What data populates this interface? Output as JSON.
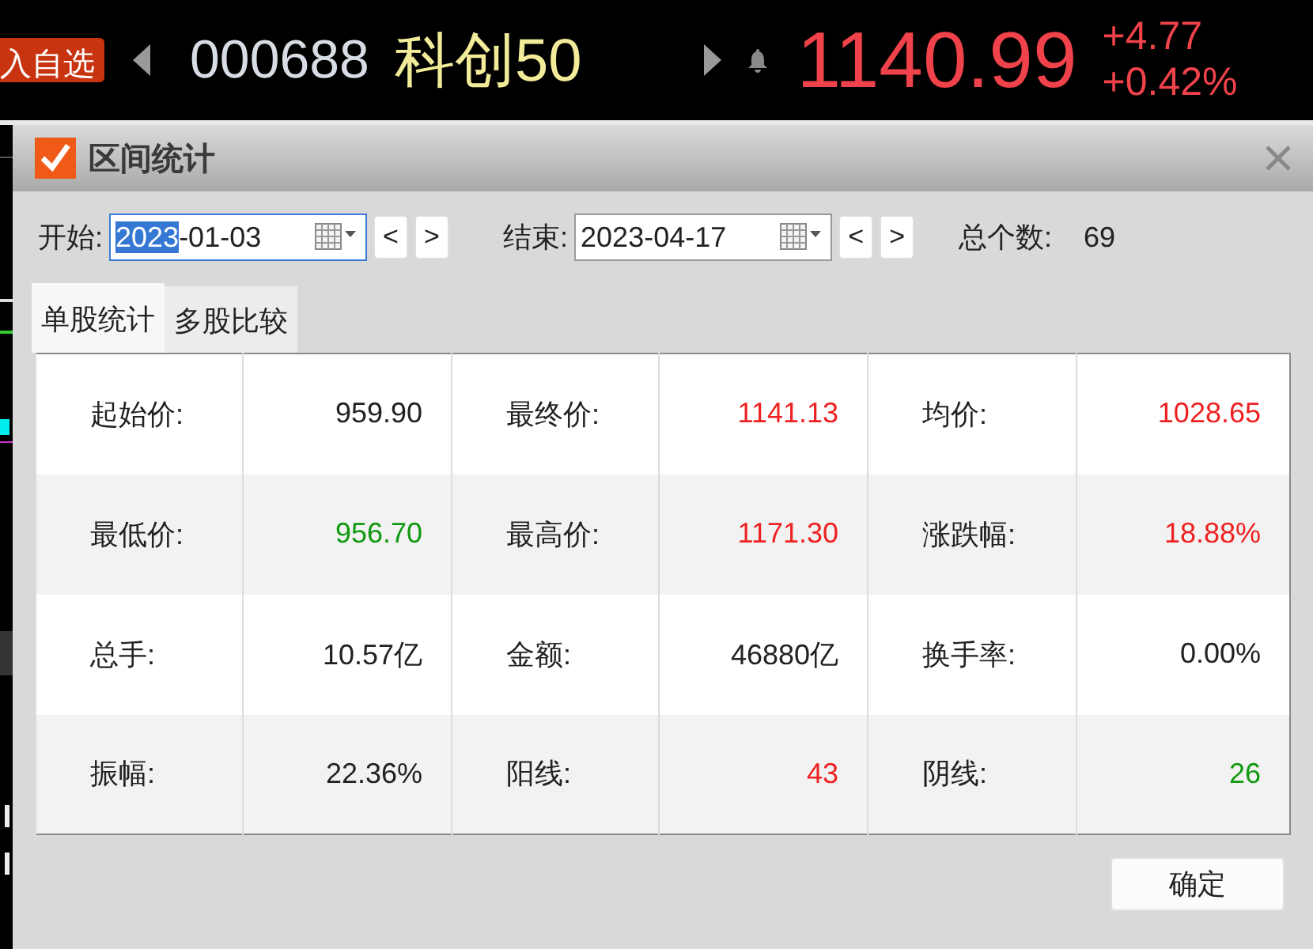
{
  "quote_bar": {
    "add_button": "入自选",
    "code": "000688",
    "name": "科创50",
    "price": "1140.99",
    "change": "+4.77",
    "change_pct": "+0.42%"
  },
  "dialog": {
    "title": "区间统计",
    "start": {
      "label": "开始:",
      "segments": [
        {
          "text": "2023",
          "selected": true
        },
        {
          "text": "-01-03",
          "selected": false
        }
      ],
      "prev": "<",
      "next": ">"
    },
    "end": {
      "label": "结束:",
      "segments": [
        {
          "text": "2023-04-17",
          "selected": false
        }
      ],
      "prev": "<",
      "next": ">"
    },
    "count_label": "总个数:",
    "count": "69",
    "tabs": [
      {
        "label": "单股统计",
        "selected": true
      },
      {
        "label": "多股比较",
        "selected": false
      }
    ],
    "rows": [
      [
        {
          "label": "起始价:",
          "value": "959.90",
          "color": "#222222"
        },
        {
          "label": "最终价:",
          "value": "1141.13",
          "color": "#ee2222"
        },
        {
          "label": "均价:",
          "value": "1028.65",
          "color": "#ee2222"
        }
      ],
      [
        {
          "label": "最低价:",
          "value": "956.70",
          "color": "#119911"
        },
        {
          "label": "最高价:",
          "value": "1171.30",
          "color": "#ee2222"
        },
        {
          "label": "涨跌幅:",
          "value": "18.88%",
          "color": "#ee2222"
        }
      ],
      [
        {
          "label": "总手:",
          "value": "10.57亿",
          "color": "#222222"
        },
        {
          "label": "金额:",
          "value": "46880亿",
          "color": "#222222"
        },
        {
          "label": "换手率:",
          "value": "0.00%",
          "color": "#222222"
        }
      ],
      [
        {
          "label": "振幅:",
          "value": "22.36%",
          "color": "#222222"
        },
        {
          "label": "阳线:",
          "value": "43",
          "color": "#ee2222"
        },
        {
          "label": "阴线:",
          "value": "26",
          "color": "#119911"
        }
      ]
    ],
    "ok_button": "确定"
  }
}
